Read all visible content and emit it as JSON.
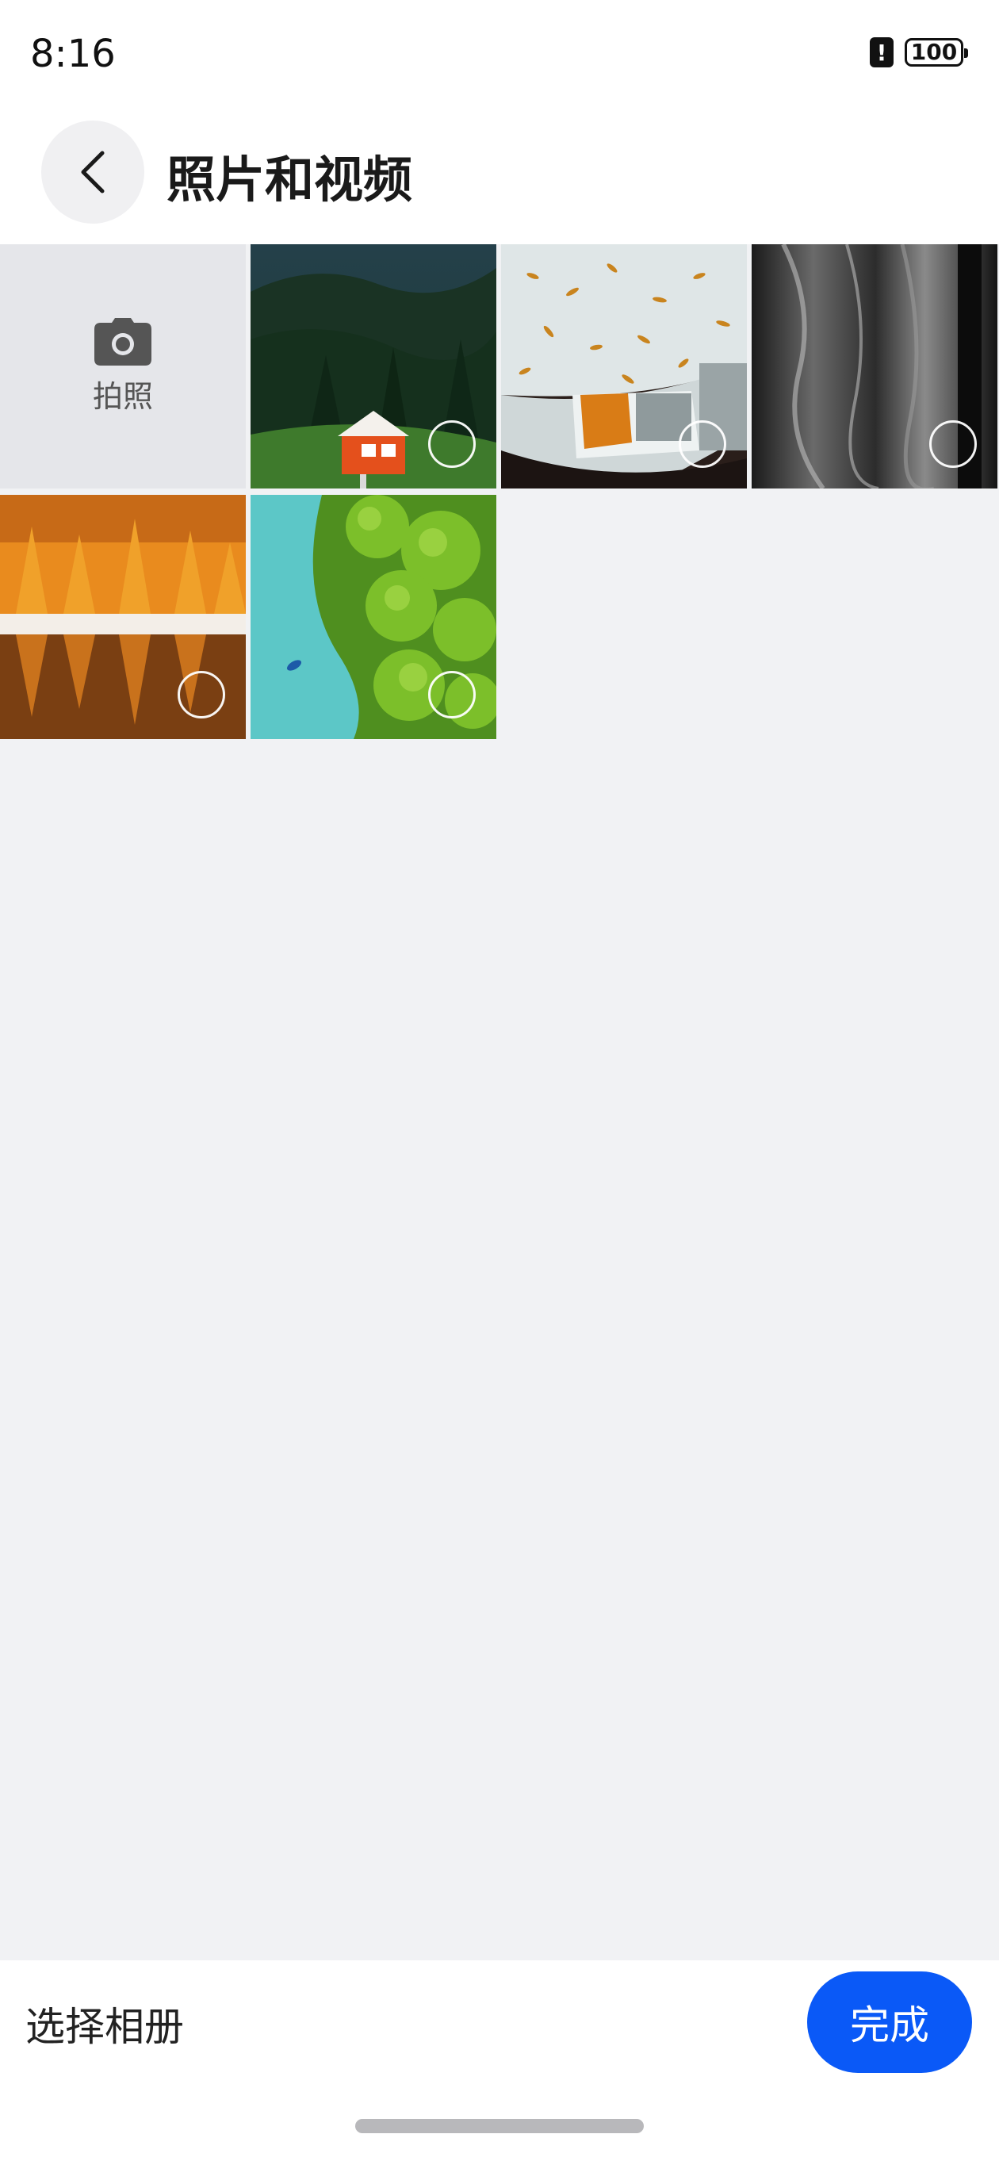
{
  "status_bar": {
    "time": "8:16",
    "alert_glyph": "!",
    "battery": "100"
  },
  "header": {
    "title": "照片和视频",
    "back_icon": "chevron-left-icon"
  },
  "grid": {
    "camera_tile": {
      "label": "拍照",
      "icon": "camera-icon"
    },
    "photos": [
      {
        "subject": "forest-cabin"
      },
      {
        "subject": "car-with-leaves"
      },
      {
        "subject": "monochrome-abstract"
      },
      {
        "subject": "autumn-lake"
      },
      {
        "subject": "aerial-river-trees"
      }
    ]
  },
  "bottom_bar": {
    "album_select_label": "选择相册",
    "done_label": "完成"
  },
  "colors": {
    "accent": "#0a59f7",
    "background": "#f1f2f4",
    "camera_tile_bg": "#e5e6ea"
  }
}
